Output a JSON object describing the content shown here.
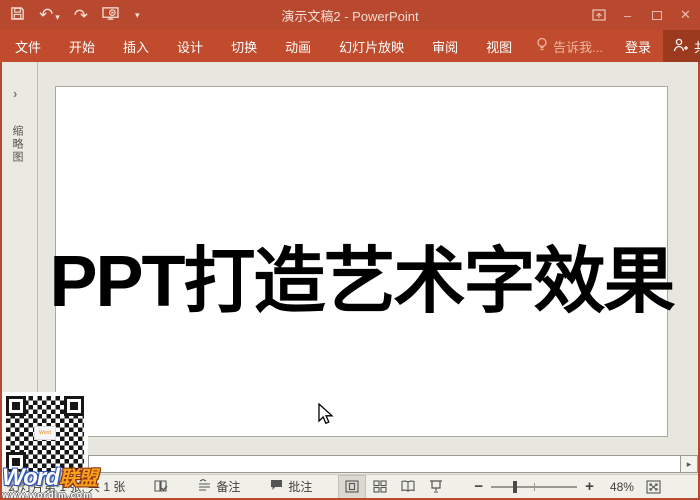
{
  "window": {
    "title": "演示文稿2 - PowerPoint",
    "minimize_glyph": "–",
    "close_glyph": "✕"
  },
  "qat": {
    "undo_glyph": "↶",
    "redo_glyph": "↷",
    "dropdown_glyph": "▾"
  },
  "ribbon": {
    "tabs": [
      "文件",
      "开始",
      "插入",
      "设计",
      "切换",
      "动画",
      "幻灯片放映",
      "审阅",
      "视图"
    ],
    "tell_me": "告诉我...",
    "sign_in": "登录",
    "share": "共享"
  },
  "thumbnail_pane": {
    "label": "缩略图",
    "expand_glyph": "›"
  },
  "slide": {
    "title_text": "PPT打造艺术字效果"
  },
  "scrollbar": {
    "right_arrow_glyph": "▸"
  },
  "status_bar": {
    "slide_counter": "幻灯片第 1 张, 共 1 张",
    "notes_label": "备注",
    "comments_label": "批注",
    "zoom_out_glyph": "−",
    "zoom_in_glyph": "+",
    "zoom_level": "48%"
  },
  "watermark": {
    "brand": "Word",
    "brand_cn": "联盟",
    "url": "www.wordlm.com"
  },
  "colors": {
    "titlebar": "#b8492e",
    "tab_row": "#c14b2d",
    "share_button": "#9c3a1f",
    "work_area": "#e7e6df",
    "watermark_blue": "#2a55b8",
    "watermark_orange": "#f6a21b"
  }
}
